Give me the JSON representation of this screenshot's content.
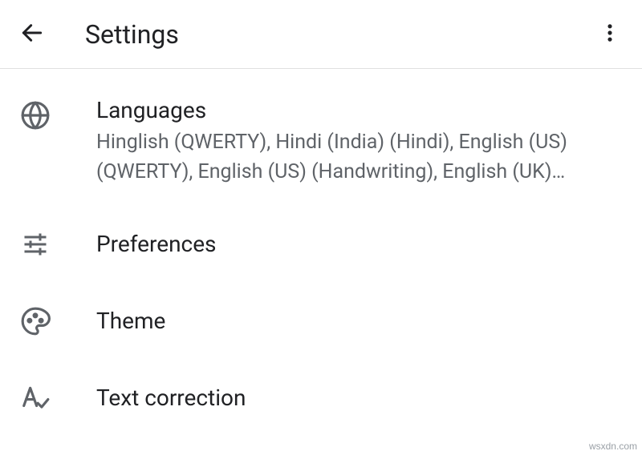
{
  "header": {
    "title": "Settings"
  },
  "items": [
    {
      "title": "Languages",
      "subtitle": "Hinglish (QWERTY), Hindi (India) (Hindi), English (US) (QWERTY), English (US) (Handwriting), English (UK) (QWERTY)"
    },
    {
      "title": "Preferences"
    },
    {
      "title": "Theme"
    },
    {
      "title": "Text correction"
    }
  ],
  "watermark": "wsxdn.com"
}
